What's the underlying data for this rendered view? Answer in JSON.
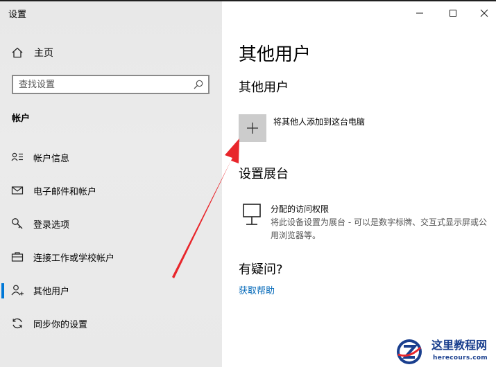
{
  "window": {
    "title": "设置"
  },
  "sidebar": {
    "home_label": "主页",
    "search_placeholder": "查找设置",
    "section_title": "帐户",
    "items": [
      {
        "icon": "account-info-icon",
        "label": "帐户信息"
      },
      {
        "icon": "mail-icon",
        "label": "电子邮件和帐户"
      },
      {
        "icon": "key-icon",
        "label": "登录选项"
      },
      {
        "icon": "briefcase-icon",
        "label": "连接工作或学校帐户"
      },
      {
        "icon": "person-add-icon",
        "label": "其他用户",
        "active": true
      },
      {
        "icon": "sync-icon",
        "label": "同步你的设置"
      }
    ]
  },
  "main": {
    "page_title": "其他用户",
    "other_users_title": "其他用户",
    "add_label": "将其他人添加到这台电脑",
    "kiosk_title": "设置展台",
    "kiosk_item_title": "分配的访问权限",
    "kiosk_item_desc": "将此设备设置为展台 - 可以是数字标牌、交互式显示屏或公用浏览器等。",
    "question_title": "有疑问?",
    "help_link": "获取帮助"
  },
  "colors": {
    "accent": "#0078d7",
    "link": "#0067b8",
    "arrow": "#e8262b",
    "sidebar_bg": "#e9e9e9"
  },
  "watermark": {
    "text": "这里教程网",
    "url": "herecours.com"
  }
}
